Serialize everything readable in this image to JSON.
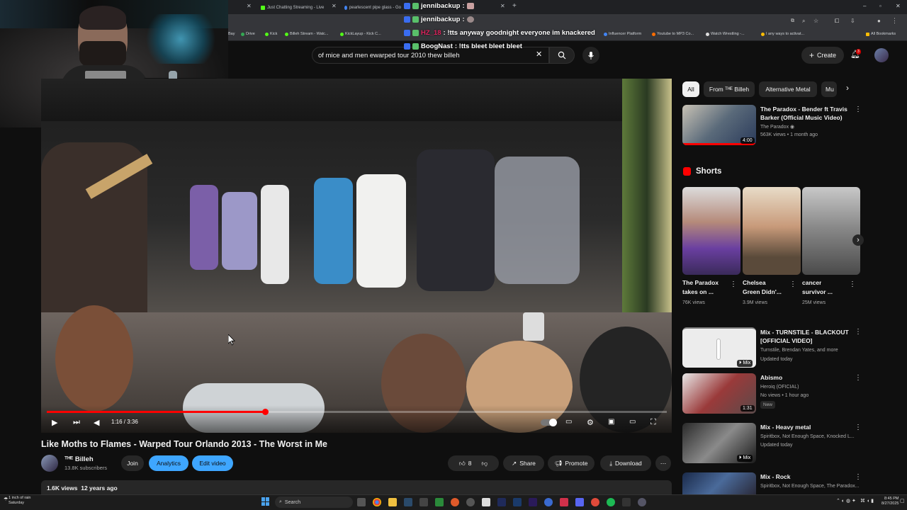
{
  "browser": {
    "tabs": [
      {
        "label": "Just Chatting Streaming - Live",
        "color": "#53fc18"
      },
      {
        "label": "pearlescent pipe glass - Go",
        "color": "#4285f4"
      }
    ],
    "bookmarks": [
      "Bay",
      "Drive",
      "Kick",
      "Billeh Stream - Watc...",
      "KickLayup - Kick C...",
      "Influencer Platform",
      "Youtube to MP3 Co...",
      "Watch Wrestling -...",
      "I any ways to activat..."
    ],
    "all_bookmarks": "All Bookmarks"
  },
  "chat": [
    {
      "user": "jennibackup",
      "msg": ":",
      "user_color": "#ffffff"
    },
    {
      "user": "jennibackup",
      "msg": ":",
      "user_color": "#ffffff"
    },
    {
      "user": "HZ_18",
      "msg": ": !tts anyway goodnight everyone im knackered",
      "user_color": "#e0245e"
    },
    {
      "user": "BoogNast",
      "msg": ": !tts bleet bleet bleet",
      "user_color": "#ffffff"
    }
  ],
  "header": {
    "search_value": "of mice and men ewarped tour 2010 thew billeh",
    "create_label": "Create",
    "notification_count": "3"
  },
  "player": {
    "time": "1:16 / 3:36",
    "progress": 0.352
  },
  "video": {
    "title": "Like Moths to Flames - Warped Tour Orlando 2013 - The Worst in Me",
    "channel_name": "ᵀᴴᴱ Billeh",
    "subscribers": "13.8K subscribers",
    "join_label": "Join",
    "analytics_label": "Analytics",
    "edit_label": "Edit video",
    "likes": "8",
    "share_label": "Share",
    "promote_label": "Promote",
    "download_label": "Download",
    "views": "1.6K views",
    "age": "12 years ago"
  },
  "chips": [
    "All",
    "From ᵀᴴᴱ Billeh",
    "Alternative Metal",
    "Mu"
  ],
  "recs": [
    {
      "title1": "The Paradox - Bender ft Travis",
      "title2": "Barker (Official Music Video)",
      "channel": "The Paradox",
      "meta": "563K views • 1 month ago",
      "duration": "4:00"
    },
    {
      "title1": "Mix - TURNSTILE - BLACKOUT",
      "title2": "[OFFICIAL VIDEO]",
      "channel": "Turnstile, Brendan Yates, and more",
      "meta": "Updated today",
      "duration": "Mix"
    },
    {
      "title1": "Abismo",
      "title2": "",
      "channel": "Heroiq (OFICIAL)",
      "meta": "No views • 1 hour ago",
      "duration": "1:31",
      "badge": "New"
    },
    {
      "title1": "Mix - Heavy metal",
      "title2": "",
      "channel": "Spiritbox, Not Enough Space, Knocked L...",
      "meta": "Updated today",
      "duration": "Mix"
    },
    {
      "title1": "Mix - Rock",
      "title2": "",
      "channel": "Spiritbox, Not Enough Space, The Paradox...",
      "meta": "",
      "duration": ""
    }
  ],
  "shorts": {
    "heading": "Shorts",
    "items": [
      {
        "title1": "The Paradox",
        "title2": "takes on ...",
        "views": "76K views"
      },
      {
        "title1": "Chelsea",
        "title2": "Green Didn'...",
        "views": "3.9M views"
      },
      {
        "title1": "cancer",
        "title2": "survivor ...",
        "views": "25M views"
      }
    ]
  },
  "taskbar": {
    "weather1": "1 inch of rain",
    "weather2": "Saturday",
    "search": "Search",
    "time": "8:45 PM",
    "date": "8/27/2025"
  },
  "colors": {
    "accent": "#ff0000",
    "blue_button": "#3ea6ff",
    "bg": "#0f0f0f"
  }
}
